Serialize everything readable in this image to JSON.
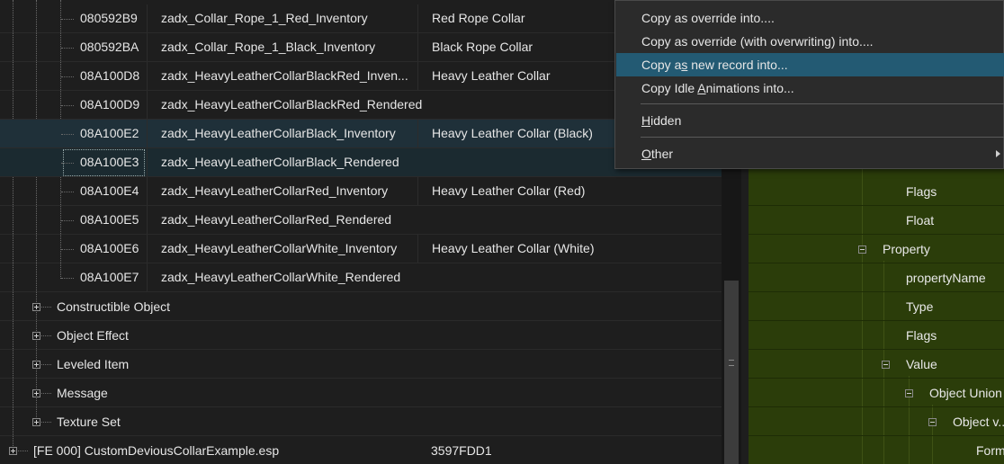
{
  "records": [
    {
      "id": "080592B9",
      "edid": "zadx_Collar_Rope_1_Red_Inventory",
      "name": "Red Rope Collar"
    },
    {
      "id": "080592BA",
      "edid": "zadx_Collar_Rope_1_Black_Inventory",
      "name": "Black Rope Collar"
    },
    {
      "id": "08A100D8",
      "edid": "zadx_HeavyLeatherCollarBlackRed_Inven...",
      "name": "Heavy Leather Collar"
    },
    {
      "id": "08A100D9",
      "edid": "zadx_HeavyLeatherCollarBlackRed_Rendered",
      "name": ""
    },
    {
      "id": "08A100E2",
      "edid": "zadx_HeavyLeatherCollarBlack_Inventory",
      "name": "Heavy Leather Collar (Black)"
    },
    {
      "id": "08A100E3",
      "edid": "zadx_HeavyLeatherCollarBlack_Rendered",
      "name": ""
    },
    {
      "id": "08A100E4",
      "edid": "zadx_HeavyLeatherCollarRed_Inventory",
      "name": "Heavy Leather Collar (Red)"
    },
    {
      "id": "08A100E5",
      "edid": "zadx_HeavyLeatherCollarRed_Rendered",
      "name": ""
    },
    {
      "id": "08A100E6",
      "edid": "zadx_HeavyLeatherCollarWhite_Inventory",
      "name": "Heavy Leather Collar (White)"
    },
    {
      "id": "08A100E7",
      "edid": "zadx_HeavyLeatherCollarWhite_Rendered",
      "name": ""
    }
  ],
  "groups": [
    "Constructible Object",
    "Object Effect",
    "Leveled Item",
    "Message",
    "Texture Set"
  ],
  "plugin": {
    "label": "[FE 000] CustomDeviousCollarExample.esp",
    "crc": "3597FDD1"
  },
  "right_tree": {
    "flags_1": "Flags",
    "float": "Float",
    "property": "Property",
    "property_name": "propertyName",
    "type": "Type",
    "flags_2": "Flags",
    "value": "Value",
    "object_union": "Object Union",
    "object_v": "Object v...",
    "form": "Form"
  },
  "menu": {
    "item1_pre": "Copy as override into....",
    "item2": "Copy as override (with overwriting) into....",
    "item3_a": "Copy a",
    "item3_u": "s",
    "item3_b": " new record into...",
    "item4_a": "Copy Idle ",
    "item4_u": "A",
    "item4_b": "nimations into...",
    "item5_u": "H",
    "item5_b": "idden",
    "item6_u": "O",
    "item6_b": "ther"
  },
  "colors": {
    "selection": "#1f3039",
    "menu_highlight": "#235a73",
    "right_bg": "#2b3d0a"
  }
}
